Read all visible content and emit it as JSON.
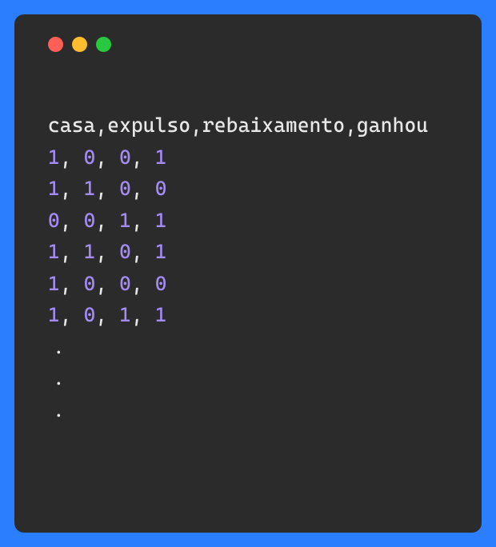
{
  "window": {
    "controls": {
      "close": "close",
      "minimize": "minimize",
      "zoom": "zoom"
    }
  },
  "code": {
    "header": "casa,expulso,rebaixamento,ganhou",
    "rows": [
      [
        "1",
        "0",
        "0",
        "1"
      ],
      [
        "1",
        "1",
        "0",
        "0"
      ],
      [
        "0",
        "0",
        "1",
        "1"
      ],
      [
        "1",
        "1",
        "0",
        "1"
      ],
      [
        "1",
        "0",
        "0",
        "0"
      ],
      [
        "1",
        "0",
        "1",
        "1"
      ]
    ],
    "ellipsis": [
      ".",
      ".",
      "."
    ]
  }
}
